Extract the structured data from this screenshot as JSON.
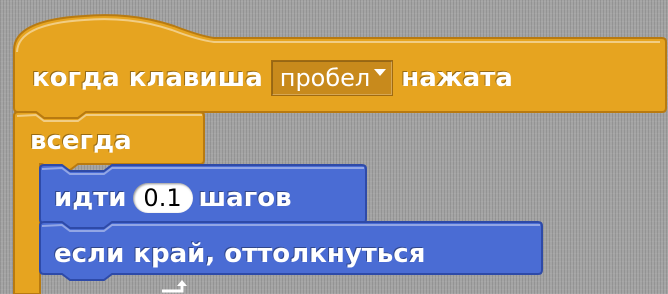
{
  "hat_block": {
    "label_before": "когда клавиша",
    "key_value": "пробел",
    "label_after": "нажата"
  },
  "forever_block": {
    "label": "всегда"
  },
  "move_block": {
    "label_before": "идти",
    "steps_value": "0.1",
    "label_after": "шагов"
  },
  "bounce_block": {
    "label": "если край, оттолкнуться"
  },
  "colors": {
    "control_block": "#e6a420",
    "control_dark": "#b87a10",
    "motion_block": "#4a6cd4",
    "motion_dark": "#2e4aa8",
    "script_area": "#a4a4a4"
  },
  "icons": {
    "dropdown": "chevron-down-icon",
    "loop": "loop-arrow-icon"
  }
}
